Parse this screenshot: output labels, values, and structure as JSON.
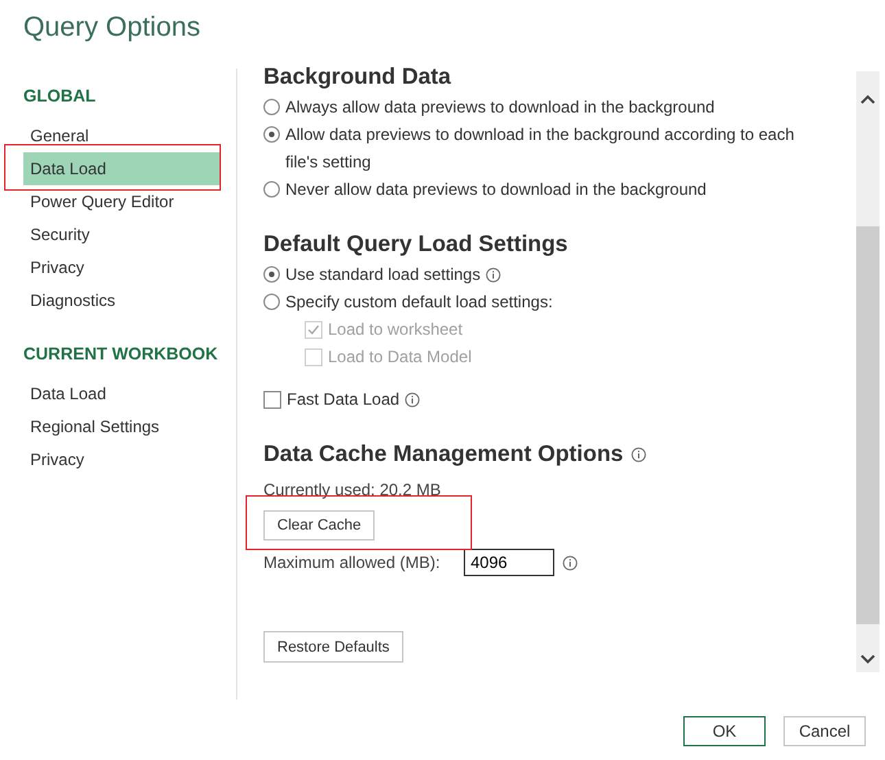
{
  "window": {
    "title": "Query Options"
  },
  "sidebar": {
    "groups": [
      {
        "heading": "GLOBAL",
        "items": [
          {
            "label": "General",
            "selected": false,
            "outlined": false
          },
          {
            "label": "Data Load",
            "selected": true,
            "outlined": true
          },
          {
            "label": "Power Query Editor",
            "selected": false,
            "outlined": false
          },
          {
            "label": "Security",
            "selected": false,
            "outlined": false
          },
          {
            "label": "Privacy",
            "selected": false,
            "outlined": false
          },
          {
            "label": "Diagnostics",
            "selected": false,
            "outlined": false
          }
        ]
      },
      {
        "heading": "CURRENT WORKBOOK",
        "items": [
          {
            "label": "Data Load",
            "selected": false,
            "outlined": false
          },
          {
            "label": "Regional Settings",
            "selected": false,
            "outlined": false
          },
          {
            "label": "Privacy",
            "selected": false,
            "outlined": false
          }
        ]
      }
    ]
  },
  "content": [
    {
      "kind": "heading",
      "text": "Background Data",
      "info": false
    },
    {
      "kind": "radio",
      "label": "Always allow data previews to download in the background",
      "selected": false,
      "info": false
    },
    {
      "kind": "radio",
      "label": "Allow data previews to download in the background according to each file's setting",
      "selected": true,
      "info": false
    },
    {
      "kind": "radio",
      "label": "Never allow data previews to download in the background",
      "selected": false,
      "info": false
    },
    {
      "kind": "heading",
      "text": "Default Query Load Settings",
      "info": false
    },
    {
      "kind": "radio",
      "label": "Use standard load settings",
      "selected": true,
      "info": true
    },
    {
      "kind": "radio",
      "label": "Specify custom default load settings:",
      "selected": false,
      "info": false,
      "children": [
        {
          "label": "Load to worksheet",
          "checked": true,
          "disabled": true
        },
        {
          "label": "Load to Data Model",
          "checked": false,
          "disabled": true
        }
      ]
    },
    {
      "kind": "checkbox",
      "label": "Fast Data Load",
      "checked": false,
      "disabled": false,
      "info": true
    },
    {
      "kind": "heading",
      "text": "Data Cache Management Options",
      "info": true
    },
    {
      "kind": "text",
      "text": "Currently used: 20.2 MB"
    },
    {
      "kind": "button",
      "label": "Clear Cache",
      "outlined": true
    },
    {
      "kind": "field",
      "label": "Maximum allowed (MB):",
      "value": "4096",
      "info": true
    }
  ],
  "restore_defaults": {
    "label": "Restore Defaults"
  },
  "footer_buttons": [
    {
      "label": "OK",
      "default": true
    },
    {
      "label": "Cancel",
      "default": false
    }
  ]
}
